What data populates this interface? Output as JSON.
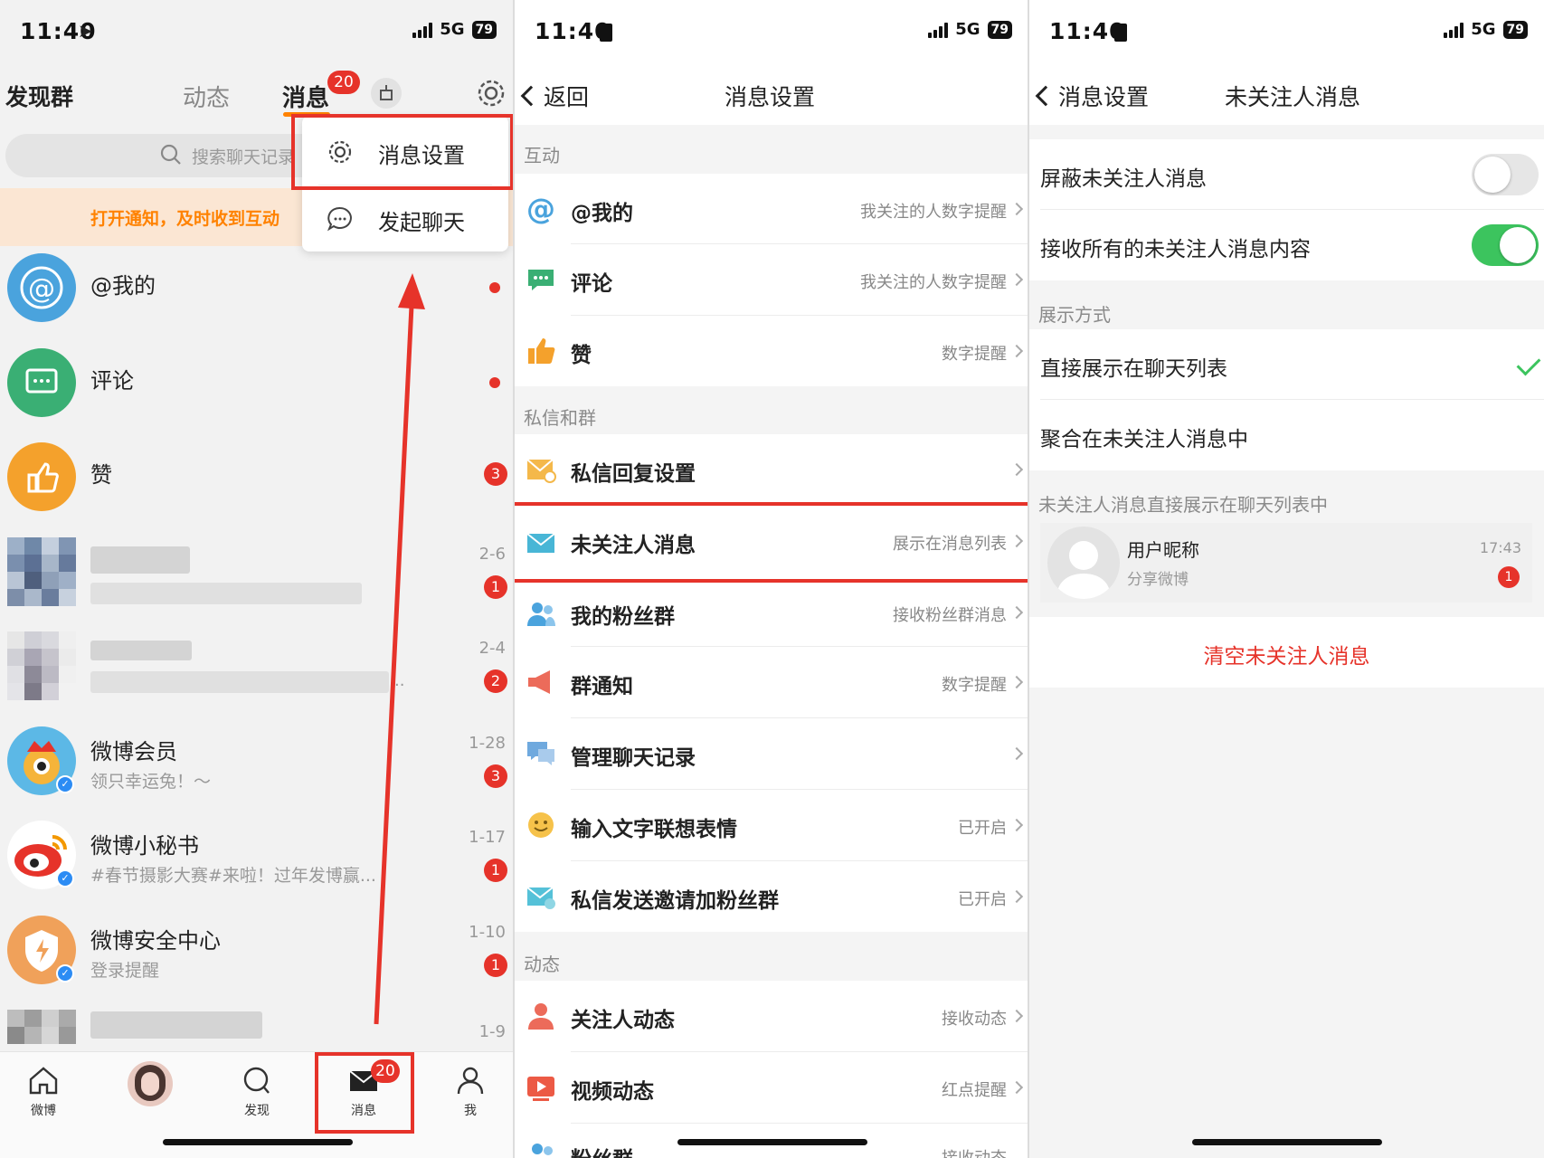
{
  "status": {
    "time": "11:40",
    "network": "5G",
    "battery": "79"
  },
  "p1": {
    "header": {
      "left_title": "发现群",
      "tab_dynamic": "动态",
      "tab_messages": "消息",
      "tab_messages_badge": "20"
    },
    "search_placeholder": "搜索聊天记录",
    "notify_text": "打开通知，及时收到互动",
    "dropdown": {
      "settings": "消息设置",
      "start_chat": "发起聊天"
    },
    "list": [
      {
        "name": "@我的"
      },
      {
        "name": "评论"
      },
      {
        "name": "赞",
        "count": "3"
      },
      {
        "date": "2-6",
        "count": "1"
      },
      {
        "date": "2-4",
        "count": "2",
        "ellipsis": ".."
      },
      {
        "name": "微博会员",
        "sub": "领只幸运兔！～",
        "date": "1-28",
        "count": "3"
      },
      {
        "name": "微博小秘书",
        "sub": "#春节摄影大赛#来啦！过年发博赢...",
        "date": "1-17",
        "count": "1"
      },
      {
        "name": "微博安全中心",
        "sub": "登录提醒",
        "date": "1-10",
        "count": "1"
      },
      {
        "date": "1-9"
      }
    ],
    "tabbar": {
      "weibo": "微博",
      "discover": "发现",
      "messages": "消息",
      "messages_badge": "20",
      "me": "我"
    }
  },
  "p2": {
    "back": "返回",
    "title": "消息设置",
    "sections": {
      "interaction": "互动",
      "dm": "私信和群",
      "dynamic": "动态"
    },
    "rows": [
      {
        "label": "@我的",
        "value": "我关注的人数字提醒"
      },
      {
        "label": "评论",
        "value": "我关注的人数字提醒"
      },
      {
        "label": "赞",
        "value": "数字提醒"
      },
      {
        "label": "私信回复设置",
        "value": ""
      },
      {
        "label": "未关注人消息",
        "value": "展示在消息列表"
      },
      {
        "label": "我的粉丝群",
        "value": "接收粉丝群消息"
      },
      {
        "label": "群通知",
        "value": "数字提醒"
      },
      {
        "label": "管理聊天记录",
        "value": ""
      },
      {
        "label": "输入文字联想表情",
        "value": "已开启"
      },
      {
        "label": "私信发送邀请加粉丝群",
        "value": "已开启"
      },
      {
        "label": "关注人动态",
        "value": "接收动态"
      },
      {
        "label": "视频动态",
        "value": "红点提醒"
      },
      {
        "label": "粉丝群",
        "value": "接收动态"
      }
    ]
  },
  "p3": {
    "back": "消息设置",
    "title": "未关注人消息",
    "block_label": "屏蔽未关注人消息",
    "block_on": false,
    "receive_label": "接收所有的未关注人消息内容",
    "receive_on": true,
    "display_section": "展示方式",
    "option_direct": "直接展示在聊天列表",
    "option_aggregate": "聚合在未关注人消息中",
    "preview_section": "未关注人消息直接展示在聊天列表中",
    "preview": {
      "name": "用户昵称",
      "sub": "分享微博",
      "time": "17:43",
      "count": "1"
    },
    "clear_label": "清空未关注人消息"
  },
  "colors": {
    "accent_orange": "#ff8200",
    "alert_red": "#e6332a",
    "toggle_green": "#3cc45e",
    "link_red": "#e6332a"
  }
}
